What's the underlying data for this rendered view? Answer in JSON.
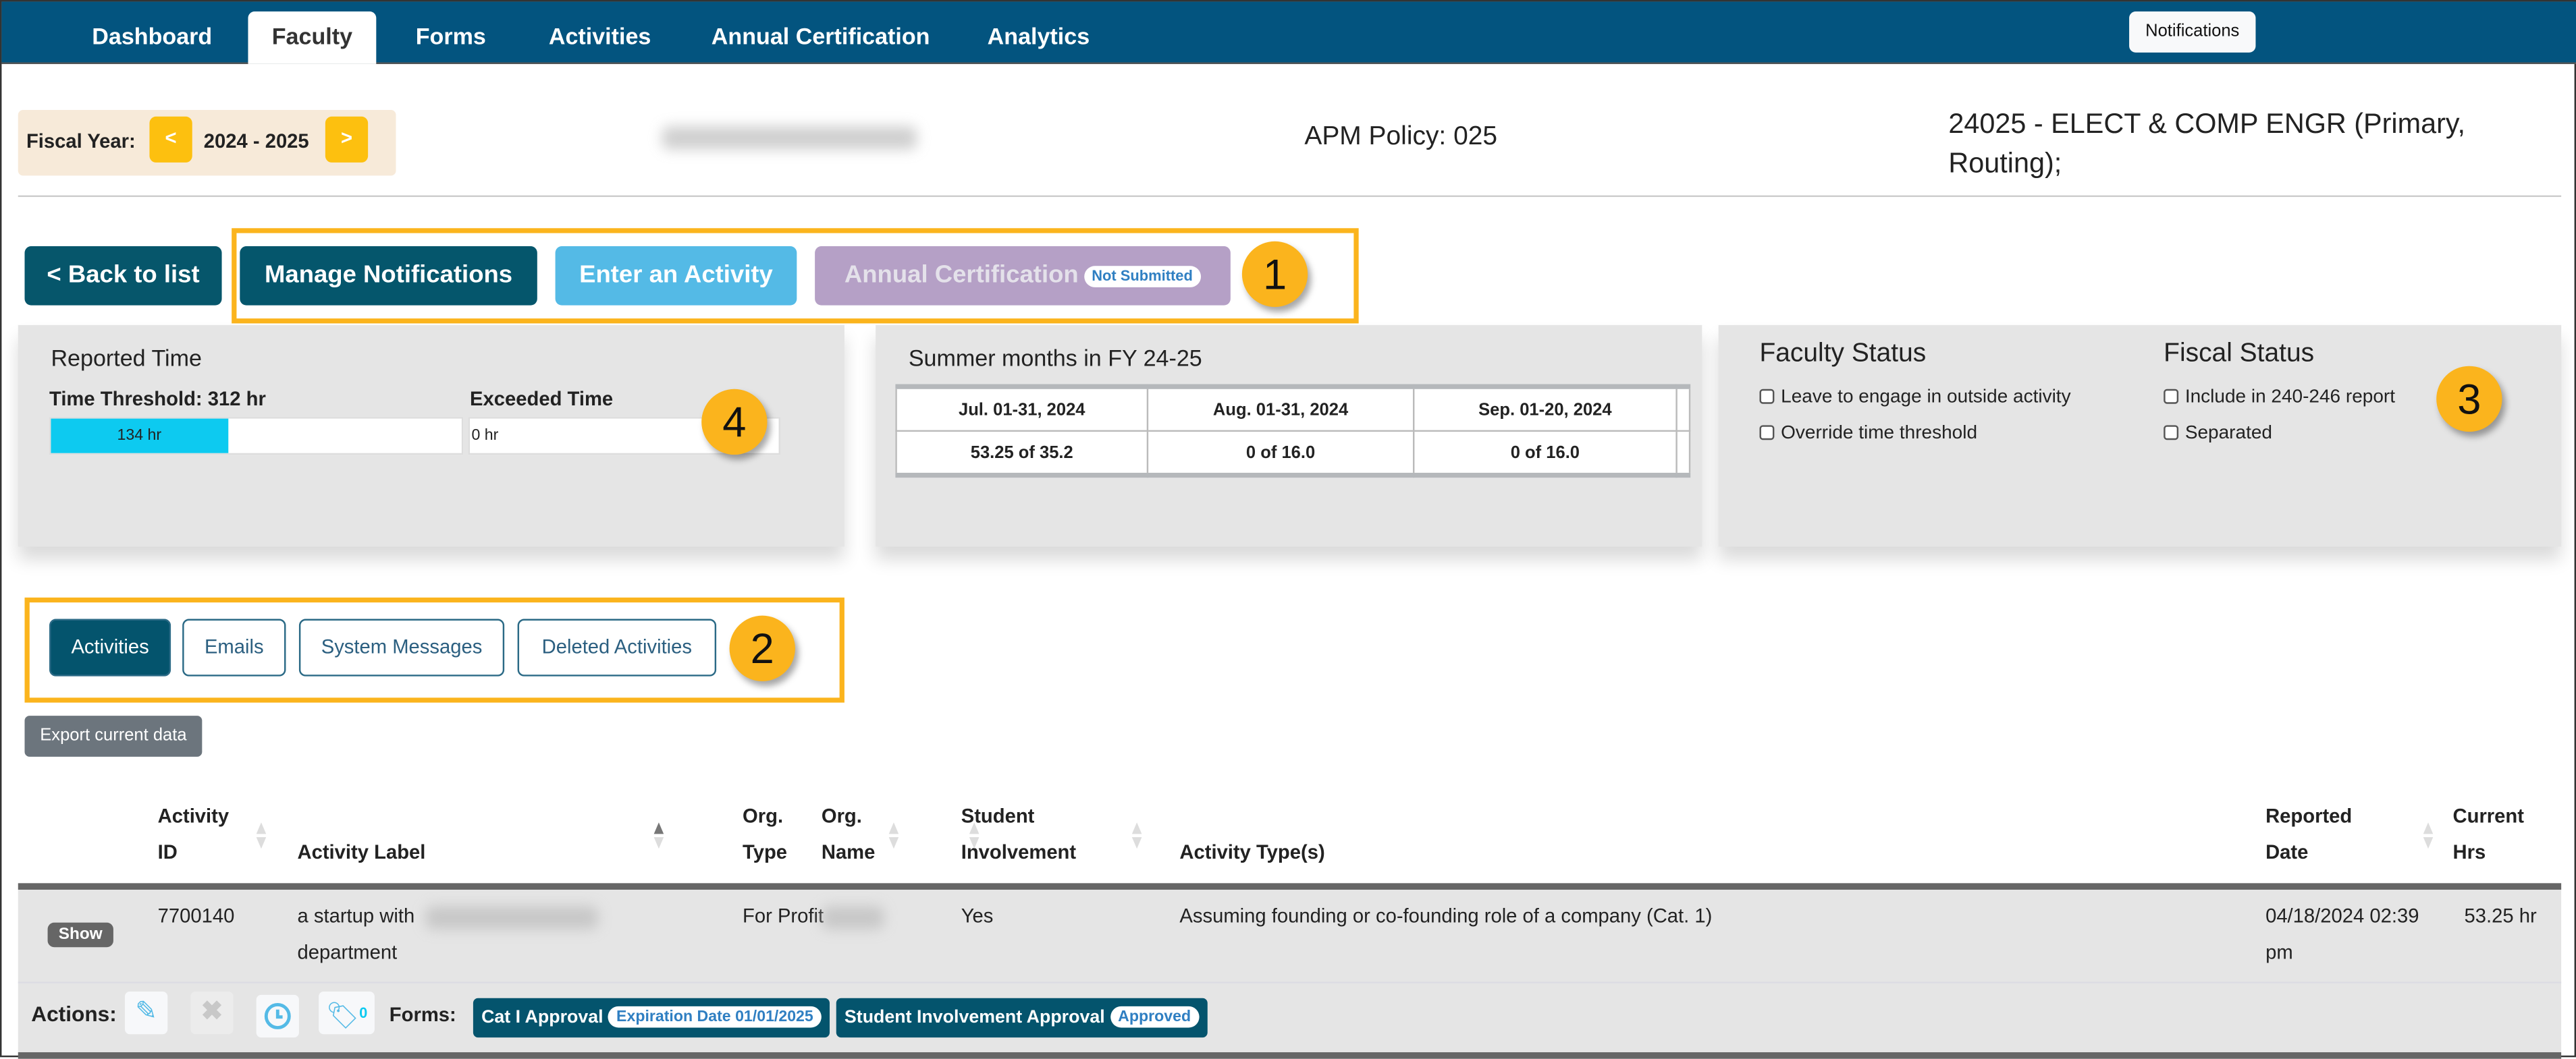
{
  "nav": {
    "tabs": [
      {
        "label": "Dashboard"
      },
      {
        "label": "Faculty",
        "active": true
      },
      {
        "label": "Forms"
      },
      {
        "label": "Activities"
      },
      {
        "label": "Annual Certification"
      },
      {
        "label": "Analytics"
      }
    ],
    "notifications_label": "Notifications"
  },
  "fiscal": {
    "label": "Fiscal Year:",
    "prev": "<",
    "value": "2024 - 2025",
    "next": ">"
  },
  "header": {
    "apm_policy": "APM Policy: 025",
    "department": "24025 - ELECT & COMP ENGR (Primary, Routing);"
  },
  "actions": {
    "back": "< Back to list",
    "manage": "Manage Notifications",
    "enter": "Enter an Activity",
    "annual": "Annual Certification",
    "annual_badge": "Not Submitted"
  },
  "callouts": {
    "c1": "1",
    "c2": "2",
    "c3": "3",
    "c4": "4"
  },
  "reported": {
    "title": "Reported Time",
    "threshold_label": "Time Threshold: 312 hr",
    "threshold_fill_fraction": 0.43,
    "threshold_value": "134 hr",
    "exceeded_label": "Exceeded Time",
    "exceeded_value": "0 hr"
  },
  "summer": {
    "title": "Summer months in FY 24-25",
    "headers": [
      "Jul. 01-31, 2024",
      "Aug. 01-31, 2024",
      "Sep. 01-20, 2024"
    ],
    "values": [
      "53.25 of 35.2",
      "0 of 16.0",
      "0 of 16.0"
    ]
  },
  "status": {
    "faculty_title": "Faculty Status",
    "faculty": [
      "Leave to engage in outside activity",
      "Override time threshold"
    ],
    "fiscal_title": "Fiscal Status",
    "fiscal": [
      "Include in 240-246 report",
      "Separated"
    ]
  },
  "tabs": [
    "Activities",
    "Emails",
    "System Messages",
    "Deleted Activities"
  ],
  "export": "Export current data",
  "table": {
    "headers": [
      "Activity\nID",
      "Activity Label",
      "Org.\nType",
      "Org.\nName",
      "Student\nInvolvement",
      "Activity Type(s)",
      "Reported\nDate",
      "Current\nHrs"
    ],
    "row": {
      "show": "Show",
      "id": "7700140",
      "label_start": "a startup with",
      "label_end": "department",
      "org_type": "For Profit",
      "student": "Yes",
      "type": "Assuming founding or co-founding role of a company (Cat. 1)",
      "date": "04/18/2024 02:39\npm",
      "hrs": "53.25 hr"
    },
    "actions_label": "Actions:",
    "tag_count": "0",
    "forms_label": "Forms:",
    "forms": [
      {
        "name": "Cat I Approval",
        "badge": "Expiration Date 01/01/2025"
      },
      {
        "name": "Student Involvement Approval",
        "badge": "Approved"
      }
    ]
  },
  "colors": {
    "nav": "#03547f",
    "accent": "#fbb41d",
    "dark_teal": "#04546d",
    "light_blue": "#54bae6",
    "purple": "#b5a0c6",
    "progress": "#0dcaf0"
  }
}
